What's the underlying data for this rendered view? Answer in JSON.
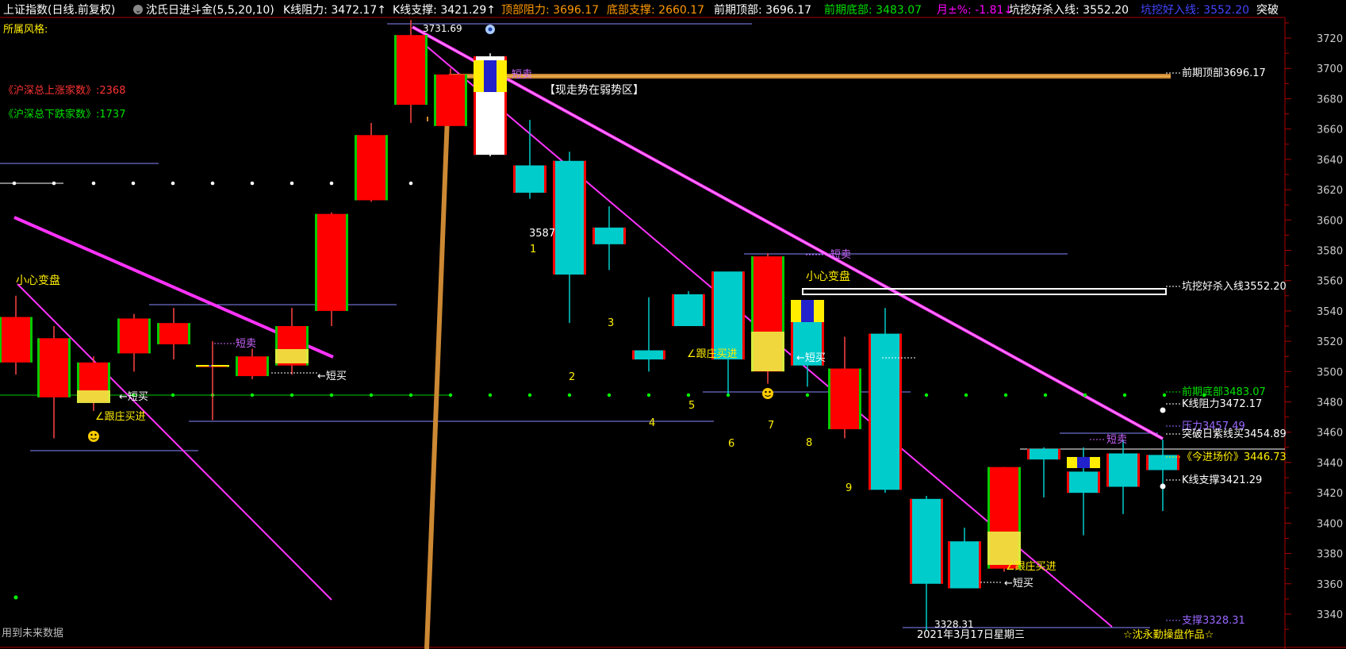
{
  "header": {
    "symbol": "上证指数(日线.前复权)",
    "indicator": "沈氏日进斗金(5,5,20,10)",
    "items": [
      {
        "text": "K线阻力: 3472.17↑",
        "color": "#ffffff"
      },
      {
        "text": "K线支撑: 3421.29↑",
        "color": "#ffffff"
      },
      {
        "text": "顶部阻力: 3696.17",
        "color": "#ff9900"
      },
      {
        "text": "底部支撑: 2660.17",
        "color": "#ff9900"
      },
      {
        "text": "前期顶部: 3696.17",
        "color": "#ffffff"
      },
      {
        "text": "前期底部: 3483.07",
        "color": "#00e000"
      },
      {
        "text": "月±%: -1.81↓",
        "color": "#ff00ff"
      },
      {
        "text": "坑挖好杀入线: 3552.20",
        "color": "#ffffff"
      },
      {
        "text": "坑挖好入线: 3552.20",
        "color": "#4444ff"
      },
      {
        "text": "突破",
        "color": "#ffffff"
      }
    ],
    "style_label": "所属风格:"
  },
  "stats": {
    "up_count": "《沪深总上涨家数》:2368",
    "down_count": "《沪深总下跌家数》:1737"
  },
  "footer": {
    "future_data": "用到未来数据",
    "date": "2021年3月17日星期三",
    "author": "☆沈永勤操盘作品☆"
  },
  "chart_data": {
    "type": "candlestick",
    "yaxis": {
      "min": 3328,
      "max": 3732,
      "ticks": [
        3340,
        3360,
        3380,
        3400,
        3420,
        3440,
        3460,
        3480,
        3500,
        3520,
        3540,
        3560,
        3580,
        3600,
        3620,
        3640,
        3660,
        3680,
        3700,
        3720
      ]
    },
    "candles": [
      {
        "o": 3536,
        "h": 3550,
        "l": 3498,
        "c": 3506,
        "color": "red"
      },
      {
        "o": 3522,
        "h": 3530,
        "l": 3456,
        "c": 3483,
        "color": "red"
      },
      {
        "o": 3506,
        "h": 3510,
        "l": 3474,
        "c": 3480,
        "color": "red"
      },
      {
        "o": 3535,
        "h": 3538,
        "l": 3500,
        "c": 3512,
        "color": "red"
      },
      {
        "o": 3532,
        "h": 3542,
        "l": 3508,
        "c": 3518,
        "color": "red"
      },
      {
        "o": 3504,
        "h": 3520,
        "l": 3468,
        "c": 3503,
        "color": "red"
      },
      {
        "o": 3510,
        "h": 3515,
        "l": 3495,
        "c": 3497,
        "color": "red"
      },
      {
        "o": 3530,
        "h": 3542,
        "l": 3498,
        "c": 3504,
        "color": "red"
      },
      {
        "o": 3604,
        "h": 3605,
        "l": 3530,
        "c": 3540,
        "color": "red"
      },
      {
        "o": 3656,
        "h": 3664,
        "l": 3612,
        "c": 3613,
        "color": "red"
      },
      {
        "o": 3722,
        "h": 3732,
        "l": 3664,
        "c": 3676,
        "color": "red"
      },
      {
        "o": 3696,
        "h": 3700,
        "l": 3662,
        "c": 3662,
        "color": "red"
      },
      {
        "o": 3708,
        "h": 3710,
        "l": 3642,
        "c": 3643,
        "color": "white"
      },
      {
        "o": 3636,
        "h": 3666,
        "l": 3614,
        "c": 3618,
        "color": "cyan"
      },
      {
        "o": 3639,
        "h": 3645,
        "l": 3532,
        "c": 3564,
        "color": "cyan"
      },
      {
        "o": 3595,
        "h": 3609,
        "l": 3567,
        "c": 3584,
        "color": "cyan"
      },
      {
        "o": 3514,
        "h": 3549,
        "l": 3500,
        "c": 3508,
        "color": "cyan"
      },
      {
        "o": 3551,
        "h": 3553,
        "l": 3530,
        "c": 3530,
        "color": "cyan"
      },
      {
        "o": 3566,
        "h": 3566,
        "l": 3485,
        "c": 3508,
        "color": "cyan"
      },
      {
        "o": 3576,
        "h": 3578,
        "l": 3492,
        "c": 3500,
        "color": "red"
      },
      {
        "o": 3540,
        "h": 3544,
        "l": 3490,
        "c": 3504,
        "color": "cyan"
      },
      {
        "o": 3502,
        "h": 3523,
        "l": 3456,
        "c": 3462,
        "color": "red"
      },
      {
        "o": 3525,
        "h": 3542,
        "l": 3420,
        "c": 3422,
        "color": "cyan"
      },
      {
        "o": 3416,
        "h": 3418,
        "l": 3329,
        "c": 3360,
        "color": "cyan"
      },
      {
        "o": 3388,
        "h": 3397,
        "l": 3358,
        "c": 3357,
        "color": "cyan"
      },
      {
        "o": 3437,
        "h": 3437,
        "l": 3368,
        "c": 3370,
        "color": "red"
      },
      {
        "o": 3449,
        "h": 3450,
        "l": 3417,
        "c": 3442,
        "color": "cyan"
      },
      {
        "o": 3434,
        "h": 3450,
        "l": 3392,
        "c": 3420,
        "color": "cyan"
      },
      {
        "o": 3446,
        "h": 3455,
        "l": 3406,
        "c": 3424,
        "color": "cyan"
      },
      {
        "o": 3445,
        "h": 3455,
        "l": 3408,
        "c": 3435,
        "color": "cyan"
      }
    ],
    "right_labels": [
      {
        "text": "前期顶部3696.17",
        "y": 3696.17,
        "color": "#ffffff"
      },
      {
        "text": "坑挖好杀入线3552.20",
        "y": 3552.2,
        "color": "#ffffff"
      },
      {
        "text": "前期底部3483.07",
        "y": 3483.07,
        "color": "#00e000"
      },
      {
        "text": "K线阻力3472.17",
        "y": 3472.17,
        "color": "#ffffff"
      },
      {
        "text": "压力3457.49",
        "y": 3457.49,
        "color": "#9966ff"
      },
      {
        "text": "突破日紫线买3454.89",
        "y": 3454.89,
        "color": "#ffffff"
      },
      {
        "text": "《今进场价》3446.73",
        "y": 3446.73,
        "color": "#ffee00"
      },
      {
        "text": "K线支撑3421.29",
        "y": 3421.29,
        "color": "#ffffff"
      },
      {
        "text": "支撑3328.31",
        "y": 3328.31,
        "color": "#9966ff"
      }
    ],
    "annotations": [
      {
        "text": "3731.69",
        "color": "#ffffff"
      },
      {
        "text": "3587",
        "color": "#ffffff"
      },
      {
        "text": "3328.31",
        "color": "#ffffff"
      },
      {
        "text": "【现走势在弱势区】",
        "color": "#ffffff"
      },
      {
        "text": "小心变盘",
        "color": "#ffee00"
      },
      {
        "text": "小心变盘",
        "color": "#ffee00"
      },
      {
        "text": "←短买",
        "color": "#ffffff"
      },
      {
        "text": "←短买",
        "color": "#ffffff"
      },
      {
        "text": "←短买",
        "color": "#ffffff"
      },
      {
        "text": "←短买",
        "color": "#ffffff"
      },
      {
        "text": "∠跟庄买进",
        "color": "#ffee00"
      },
      {
        "text": "∠跟庄买进",
        "color": "#ffee00"
      },
      {
        "text": "∠跟庄买进",
        "color": "#ffee00"
      },
      {
        "text": "短卖",
        "color": "#cc66ff"
      },
      {
        "text": "短卖",
        "color": "#cc66ff"
      },
      {
        "text": "短卖",
        "color": "#cc66ff"
      },
      {
        "text": "短卖",
        "color": "#cc66ff"
      },
      {
        "text": "1",
        "color": "#ffee00"
      },
      {
        "text": "2",
        "color": "#ffee00"
      },
      {
        "text": "3",
        "color": "#ffee00"
      },
      {
        "text": "4",
        "color": "#ffee00"
      },
      {
        "text": "5",
        "color": "#ffee00"
      },
      {
        "text": "6",
        "color": "#ffee00"
      },
      {
        "text": "7",
        "color": "#ffee00"
      },
      {
        "text": "8",
        "color": "#ffee00"
      },
      {
        "text": "9",
        "color": "#ffee00"
      }
    ],
    "colors": {
      "up": "#ff0000",
      "down": "#00cccc",
      "trend": "#ff33ff",
      "resistance": "#ff9900",
      "support_dots": "#00ff00"
    }
  }
}
